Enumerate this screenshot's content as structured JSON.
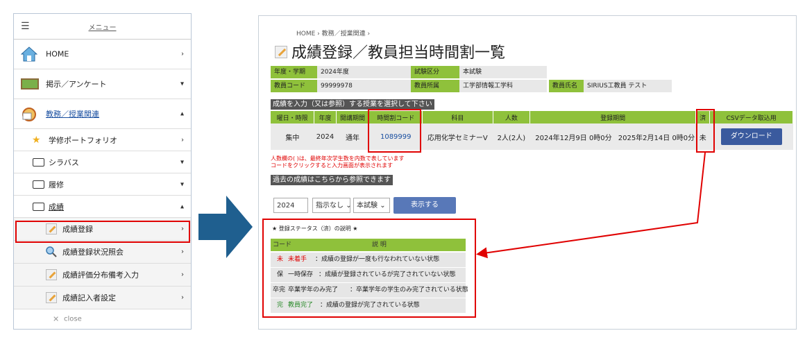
{
  "menu": {
    "header_label": "メニュー",
    "items": [
      {
        "label": "HOME",
        "arrow": "›",
        "icon": "home-icon"
      },
      {
        "label": "掲示／アンケート",
        "arrow": "▾",
        "icon": "board-icon"
      },
      {
        "label": "教務／授業関連",
        "arrow": "▴",
        "icon": "academic-icon"
      }
    ],
    "sub_items": [
      {
        "label": "学修ポートフォリオ",
        "arrow": "›",
        "icon": "star-icon"
      },
      {
        "label": "シラバス",
        "arrow": "▾",
        "icon": "folder-icon"
      },
      {
        "label": "履修",
        "arrow": "▾",
        "icon": "folder-icon"
      },
      {
        "label": "成績",
        "arrow": "▴",
        "icon": "folder-open-icon"
      }
    ],
    "grade_items": [
      {
        "label": "成績登録",
        "arrow": "›",
        "icon": "pencil-icon"
      },
      {
        "label": "成績登録状況照会",
        "arrow": "›",
        "icon": "magnifier-icon"
      },
      {
        "label": "成績評価分布備考入力",
        "arrow": "›",
        "icon": "pencil-icon"
      },
      {
        "label": "成績記入者設定",
        "arrow": "›",
        "icon": "pencil-icon"
      }
    ],
    "close_label": "close"
  },
  "page": {
    "breadcrumb": "HOME ›  教務／授業関連 ›",
    "title": "成績登録／教員担当時間割一覧"
  },
  "info": {
    "year_term_label": "年度・学期",
    "year_term_value": "2024年度",
    "exam_type_label": "試験区分",
    "exam_type_value": "本試験",
    "teacher_code_label": "教員コード",
    "teacher_code_value": "99999978",
    "teacher_dept_label": "教員所属",
    "teacher_dept_value": "工学部情報工学科",
    "teacher_name_label": "教員氏名",
    "teacher_name_value": "SIRIUS工教員 テスト"
  },
  "course_table": {
    "section_title": "成績を入力（又は参照）する授業を選択して下さい",
    "headers": [
      "曜日・時限",
      "年度",
      "開講期間",
      "時間割コード",
      "科目",
      "人数",
      "登録期間",
      "済",
      "CSVデータ取込用"
    ],
    "row": {
      "day_period": "集中",
      "year": "2024",
      "period": "通年",
      "code": "1089999",
      "subject": "応用化学セミナーⅤ",
      "count": "2人(2人)",
      "reg_start": "2024年12月9日 0時0分",
      "reg_end": "2025年2月14日 0時0分",
      "status": "未",
      "download": "ダウンロード"
    },
    "note1": "人数欄の( )は、最終年次学生数を内数で表しています",
    "note2": "コードをクリックすると入力画面が表示されます"
  },
  "past": {
    "section_title": "過去の成績はこちらから参照できます",
    "year_value": "2024",
    "term_value": "指示なし",
    "exam_value": "本試験",
    "show_button": "表示する"
  },
  "legend": {
    "title": "★ 登録ステータス（済）の説明 ★",
    "head_code": "コード",
    "head_desc": "説 明",
    "rows": [
      {
        "code": "未",
        "name": "未着手",
        "desc": "：成績の登録が一度も行なわれていない状態",
        "color": "#e00000"
      },
      {
        "code": "保",
        "name": "一時保存",
        "desc": "：成績が登録されているが完了されていない状態",
        "color": "#222222"
      },
      {
        "code": "卒完",
        "name": "卒業学年のみ完了",
        "desc": "：卒業学年の学生のみ完了されている状態",
        "color": "#222222"
      },
      {
        "code": "完",
        "name": "教員完了",
        "desc": "：成績の登録が完了されている状態",
        "color": "#2a8a2a"
      }
    ]
  },
  "colors": {
    "accent_green": "#8fc13b",
    "highlight_red": "#e00000",
    "link_blue": "#1a4fa0",
    "button_blue": "#3a5a9e",
    "arrow_blue": "#1f5f8f"
  }
}
